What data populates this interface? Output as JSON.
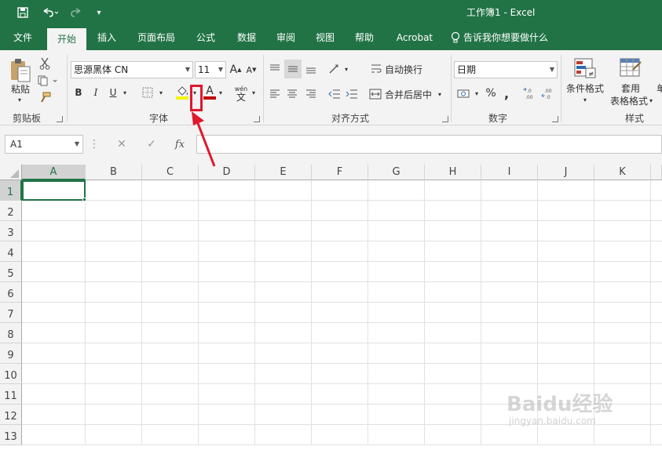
{
  "window": {
    "title": "工作簿1  -  Excel"
  },
  "quick_access": {
    "save_icon": "save-icon",
    "undo_icon": "undo-icon",
    "redo_icon": "redo-icon",
    "customize_icon": "customize-icon"
  },
  "tabs": [
    {
      "label": "文件"
    },
    {
      "label": "开始"
    },
    {
      "label": "插入"
    },
    {
      "label": "页面布局"
    },
    {
      "label": "公式"
    },
    {
      "label": "数据"
    },
    {
      "label": "审阅"
    },
    {
      "label": "视图"
    },
    {
      "label": "帮助"
    },
    {
      "label": "Acrobat"
    }
  ],
  "tell_me": "告诉我你想要做什么",
  "clipboard": {
    "paste_label": "粘贴",
    "group_label": "剪贴板"
  },
  "font": {
    "name": "思源黑体 CN",
    "size": "11",
    "group_label": "字体",
    "bold": "B",
    "italic": "I",
    "underline": "U",
    "grow": "A",
    "shrink": "A",
    "font_color_glyph": "A",
    "phonetic": "wén",
    "phonetic_char": "文",
    "fill_color": "#f5f500",
    "font_color": "#c00000"
  },
  "alignment": {
    "wrap_label": "自动换行",
    "merge_label": "合并后居中",
    "group_label": "对齐方式"
  },
  "number": {
    "format": "日期",
    "group_label": "数字",
    "percent": "%",
    "comma": ","
  },
  "styles": {
    "conditional_label": "条件格式",
    "table_label_1": "套用",
    "table_label_2": "表格格式",
    "group_label": "样式"
  },
  "formula_bar": {
    "name_box": "A1",
    "cancel": "✕",
    "enter": "✓",
    "fx": "fx"
  },
  "columns": [
    "A",
    "B",
    "C",
    "D",
    "E",
    "F",
    "G",
    "H",
    "I",
    "J",
    "K"
  ],
  "rows": [
    "1",
    "2",
    "3",
    "4",
    "5",
    "6",
    "7",
    "8",
    "9",
    "10",
    "11",
    "12",
    "13"
  ],
  "annotation": {
    "color": "#e0182d"
  },
  "watermark": {
    "text": "Baidu经验",
    "sub": "jingyan.baidu.com"
  }
}
